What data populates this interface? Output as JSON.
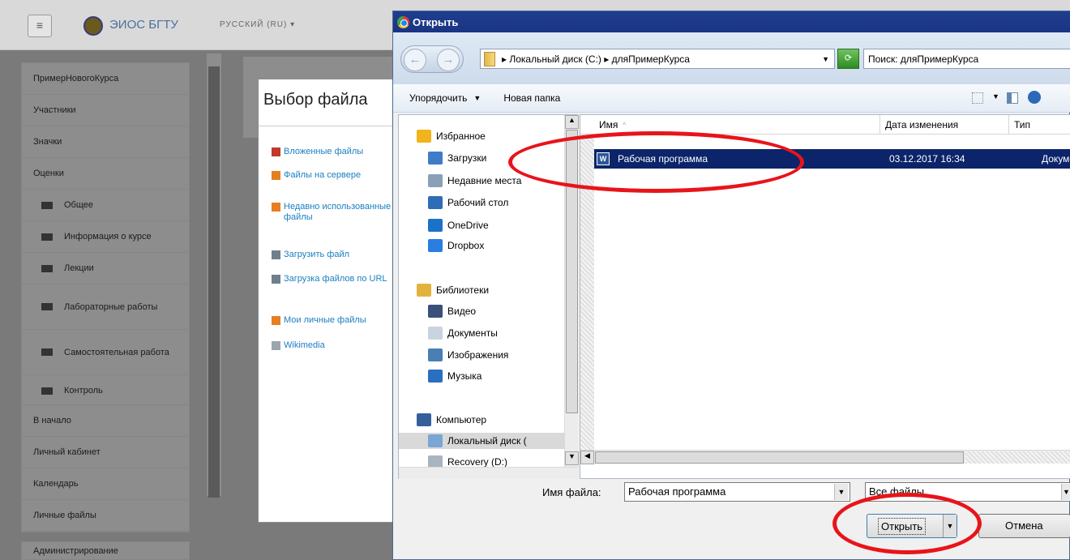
{
  "moodle": {
    "menu_icon": "hamburger-icon",
    "site_name": "ЭИОС БГТУ",
    "language": "РУССКИЙ (RU) ▾",
    "nav_group1": [
      {
        "label": "ПримерНовогоКурса",
        "folder": false,
        "sub": false
      },
      {
        "label": "Участники",
        "folder": false,
        "sub": false
      },
      {
        "label": "Значки",
        "folder": false,
        "sub": false
      },
      {
        "label": "Оценки",
        "folder": false,
        "sub": false
      },
      {
        "label": "Общее",
        "folder": true,
        "sub": true
      },
      {
        "label": "Информация о курсе",
        "folder": true,
        "sub": true
      },
      {
        "label": "Лекции",
        "folder": true,
        "sub": true
      },
      {
        "label": "Лабораторные работы",
        "folder": true,
        "sub": true
      },
      {
        "label": "Самостоятельная работа",
        "folder": true,
        "sub": true
      },
      {
        "label": "Контроль",
        "folder": true,
        "sub": true
      }
    ],
    "nav_group2": [
      "В начало",
      "Личный кабинет",
      "Календарь",
      "Личные файлы"
    ],
    "nav_group3": [
      "Администрирование"
    ]
  },
  "picker": {
    "title": "Выбор файла",
    "repositories": [
      {
        "label": "Вложенные файлы",
        "icon": "attachment-icon"
      },
      {
        "label": "Файлы на сервере",
        "icon": "server-icon"
      },
      {
        "label": "Недавно использованные файлы",
        "icon": "recent-icon"
      },
      {
        "label": "Загрузить файл",
        "icon": "upload-icon"
      },
      {
        "label": "Загрузка файлов по URL",
        "icon": "url-icon"
      },
      {
        "label": "Мои личные файлы",
        "icon": "private-files-icon"
      },
      {
        "label": "Wikimedia",
        "icon": "wikimedia-icon"
      }
    ]
  },
  "dialog": {
    "title": "Открыть",
    "address": "▸ Локальный диск (C:) ▸ дляПримерКурса",
    "search_placeholder": "Поиск: дляПримерКурса",
    "toolbar": {
      "organize": "Упорядочить",
      "new_folder": "Новая папка"
    },
    "tree": [
      {
        "label": "Избранное",
        "icon": "star-icon",
        "color": "#f2b31d"
      },
      {
        "label": "Загрузки",
        "icon": "downloads-icon",
        "color": "#3f7cc7"
      },
      {
        "label": "Недавние места",
        "icon": "recent-places-icon",
        "color": "#8aa0b8"
      },
      {
        "label": "Рабочий стол",
        "icon": "desktop-icon",
        "color": "#2f6db5"
      },
      {
        "label": "OneDrive",
        "icon": "onedrive-icon",
        "color": "#1a73c8"
      },
      {
        "label": "Dropbox",
        "icon": "dropbox-icon",
        "color": "#2a7de1"
      },
      {
        "label": "Библиотеки",
        "icon": "libraries-icon",
        "color": "#e3b23c"
      },
      {
        "label": "Видео",
        "icon": "video-icon",
        "color": "#3a4f7a"
      },
      {
        "label": "Документы",
        "icon": "documents-icon",
        "color": "#c9d4e0"
      },
      {
        "label": "Изображения",
        "icon": "pictures-icon",
        "color": "#4a7fb5"
      },
      {
        "label": "Музыка",
        "icon": "music-icon",
        "color": "#2a6fc0"
      },
      {
        "label": "Компьютер",
        "icon": "computer-icon",
        "color": "#355f9a"
      },
      {
        "label": "Локальный диск (",
        "icon": "drive-icon",
        "color": "#7aa6d4"
      },
      {
        "label": "Recovery (D:)",
        "icon": "drive-icon",
        "color": "#a8b4c0"
      }
    ],
    "columns": {
      "name": "Имя",
      "date": "Дата изменения",
      "type": "Тип"
    },
    "file": {
      "name": "Рабочая программа",
      "date": "03.12.2017 16:34",
      "type": "Документ"
    },
    "filename_label": "Имя файла:",
    "filename_value": "Рабочая программа",
    "filter_value": "Все файлы",
    "open_label": "Открыть",
    "cancel_label": "Отмена"
  },
  "annotations": {
    "color": "#e8141a",
    "circled": [
      "Рабочая программа",
      "Открыть"
    ]
  }
}
